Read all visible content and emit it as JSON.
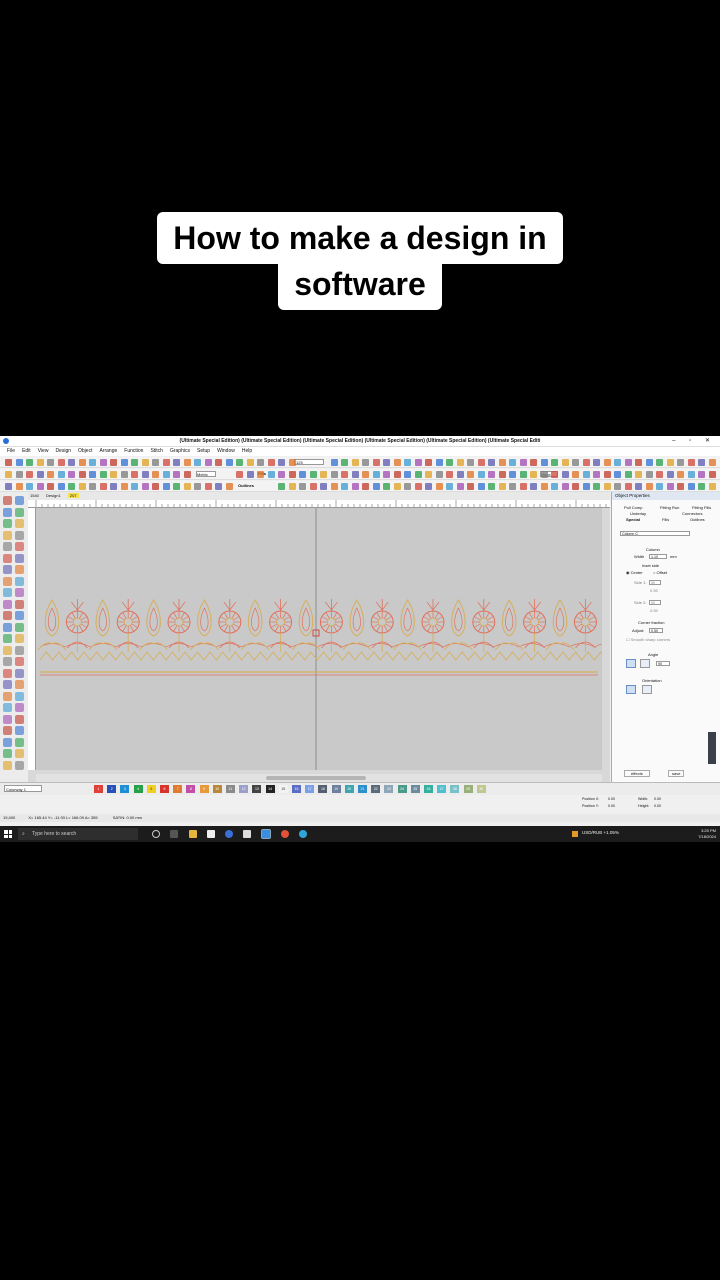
{
  "caption": {
    "line1": "How to make a design in",
    "line2": "software"
  },
  "window": {
    "title": "(Ultimate Special Edition) (Ultimate Special Edition) (Ultimate Special Edition) (Ultimate Special Edition) (Ultimate Special Edition) (Ultimate Special Editi",
    "controls": "–  ▫  ✕"
  },
  "menu": [
    "File",
    "Edit",
    "View",
    "Design",
    "Object",
    "Arrange",
    "Function",
    "Stitch",
    "Graphics",
    "Setup",
    "Window",
    "Help"
  ],
  "toolbar": {
    "zoom": "125",
    "units": "Metric",
    "fills_label": "Fills",
    "outlines_label": "Outlines",
    "none_label": "None"
  },
  "tabs": {
    "zoom_tab": "1540",
    "design_tab": "Design1",
    "extra_tab": "207"
  },
  "properties": {
    "header": "Object Properties",
    "tabs_row1": [
      "Pull Comp",
      "Fitting Run",
      "Fitting Fills"
    ],
    "tabs_row2": [
      "Underlay",
      "Connectors"
    ],
    "tabs_row3": [
      "Special",
      "Fills",
      "Outlines"
    ],
    "stitch_type": "Column C",
    "column_label": "Column",
    "width_label": "Width",
    "width_value": "1.10",
    "width_unit": "mm",
    "inset_label": "Inset side",
    "center_label": "Center",
    "offset_label": "Offset",
    "side1_label": "Side 1:",
    "side1_value": "50",
    "side1_mm": "0.55",
    "side2_label": "Side 2:",
    "side2_value": "50",
    "side2_mm": "0.55",
    "corner_label": "Corner fraction",
    "adjust_label": "Adjust:",
    "adjust_value": "0.50",
    "sharp_label": "Smooth sharp corners",
    "angle_label": "Angle",
    "angle_value": "90",
    "orientation_label": "Orientation",
    "effects_label": "effects",
    "save_label": "save"
  },
  "palette": {
    "colorway": "Colorway 1",
    "swatches": [
      {
        "n": "1",
        "c": "#e0403a"
      },
      {
        "n": "2",
        "c": "#2a4fb8"
      },
      {
        "n": "3",
        "c": "#1e8fd4"
      },
      {
        "n": "4",
        "c": "#27a04a"
      },
      {
        "n": "5",
        "c": "#f0d020"
      },
      {
        "n": "6",
        "c": "#d9342b"
      },
      {
        "n": "7",
        "c": "#e07a2e"
      },
      {
        "n": "8",
        "c": "#c24ea8"
      },
      {
        "n": "9",
        "c": "#e89a3a"
      },
      {
        "n": "10",
        "c": "#b9873a"
      },
      {
        "n": "11",
        "c": "#8a8a8a"
      },
      {
        "n": "12",
        "c": "#9aa0c8"
      },
      {
        "n": "13",
        "c": "#444444"
      },
      {
        "n": "14",
        "c": "#222222"
      },
      {
        "n": "15",
        "c": "#f2f2f2"
      },
      {
        "n": "16",
        "c": "#5c6ec4"
      },
      {
        "n": "17",
        "c": "#7aa0e8"
      },
      {
        "n": "18",
        "c": "#566070"
      },
      {
        "n": "19",
        "c": "#6f7fa0"
      },
      {
        "n": "20",
        "c": "#3fa6b0"
      },
      {
        "n": "21",
        "c": "#2e8fcc"
      },
      {
        "n": "22",
        "c": "#5c6b7a"
      },
      {
        "n": "23",
        "c": "#8fa6b8"
      },
      {
        "n": "24",
        "c": "#4a9a8a"
      },
      {
        "n": "25",
        "c": "#6b8c9c"
      },
      {
        "n": "26",
        "c": "#35b0a0"
      },
      {
        "n": "27",
        "c": "#50c0d0"
      },
      {
        "n": "28",
        "c": "#7ac0c8"
      },
      {
        "n": "29",
        "c": "#9ab07a"
      },
      {
        "n": "30",
        "c": "#c0c890"
      }
    ]
  },
  "position": {
    "x_label": "Position X:",
    "x_value": "0.00",
    "y_label": "Position Y:",
    "y_value": "0.00",
    "w_label": "Width:",
    "w_value": "0.00",
    "h_label": "Height:",
    "h_value": "0.00"
  },
  "status": {
    "coords": "X= 165.44 Y= -11.93 L= 166.09 A= 355",
    "satin": "SATIN: 0.00 mm",
    "left": "19,400"
  },
  "taskbar": {
    "search_placeholder": "Type here to search",
    "ticker": "USD/RUB +1.05%",
    "time": "3:25 PM",
    "date": "7/18/2024"
  },
  "colors": {
    "design_red": "#e0705a",
    "design_gold": "#d6b060",
    "canvas_bg": "#c9c9c9"
  }
}
